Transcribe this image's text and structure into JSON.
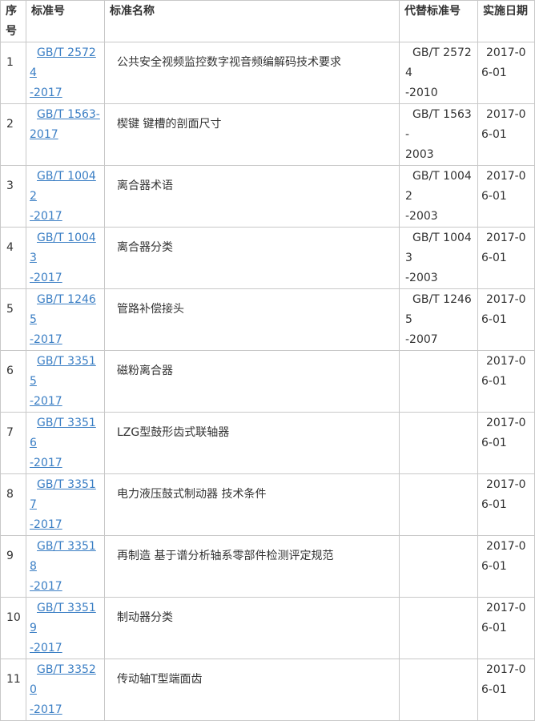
{
  "headers": {
    "no": "序号",
    "code": "标准号",
    "name": "标准名称",
    "replaced": "代替标准号",
    "date": "实施日期"
  },
  "rows": [
    {
      "no": "1",
      "code": "GB/T 25724-2017",
      "name": "公共安全视频监控数字视音频编解码技术要求",
      "replaced": "GB/T 25724-2010",
      "date": "2017-06-01"
    },
    {
      "no": "2",
      "code": "GB/T 1563-2017",
      "name": "楔键 键槽的剖面尺寸",
      "replaced": "GB/T 1563-2003",
      "date": "2017-06-01"
    },
    {
      "no": "3",
      "code": "GB/T 10042-2017",
      "name": "离合器术语",
      "replaced": "GB/T 10042-2003",
      "date": "2017-06-01"
    },
    {
      "no": "4",
      "code": "GB/T 10043-2017",
      "name": "离合器分类",
      "replaced": "GB/T 10043-2003",
      "date": "2017-06-01"
    },
    {
      "no": "5",
      "code": "GB/T 12465-2017",
      "name": "管路补偿接头",
      "replaced": "GB/T 12465-2007",
      "date": "2017-06-01"
    },
    {
      "no": "6",
      "code": "GB/T 33515-2017",
      "name": "磁粉离合器",
      "replaced": "",
      "date": "2017-06-01"
    },
    {
      "no": "7",
      "code": "GB/T 33516-2017",
      "name": "LZG型鼓形齿式联轴器",
      "replaced": "",
      "date": "2017-06-01"
    },
    {
      "no": "8",
      "code": "GB/T 33517-2017",
      "name": "电力液压鼓式制动器 技术条件",
      "replaced": "",
      "date": "2017-06-01"
    },
    {
      "no": "9",
      "code": "GB/T 33518-2017",
      "name": "再制造 基于谱分析轴系零部件检测评定规范",
      "replaced": "",
      "date": "2017-06-01"
    },
    {
      "no": "10",
      "code": "GB/T 33519-2017",
      "name": "制动器分类",
      "replaced": "",
      "date": "2017-06-01"
    },
    {
      "no": "11",
      "code": "GB/T 33520-2017",
      "name": "传动轴T型端面齿",
      "replaced": "",
      "date": "2017-06-01"
    }
  ],
  "colors": {
    "link": "#3a7ec4",
    "border": "#c8c8c8",
    "text": "#333333"
  }
}
